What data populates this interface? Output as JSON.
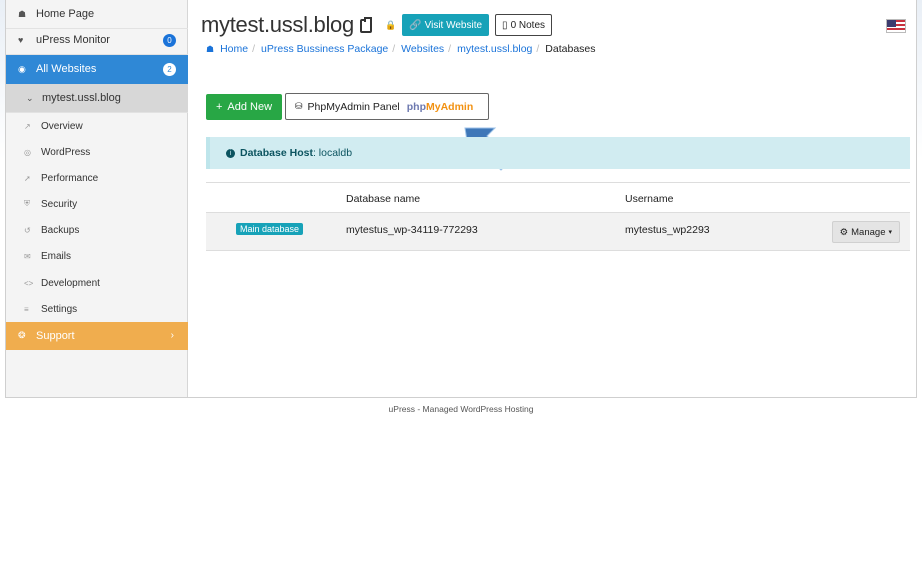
{
  "sidebar": {
    "items": [
      {
        "label": "Home Page",
        "icon": "home-icon"
      },
      {
        "label": "uPress Monitor",
        "icon": "heartbeat-icon",
        "badge": "0"
      },
      {
        "label": "All Websites",
        "icon": "globe-icon",
        "badge": "2"
      },
      {
        "label": "mytest.ussl.blog",
        "icon": "chevron-down-icon"
      }
    ],
    "sub_items": [
      {
        "label": "Overview",
        "icon": "chart-icon"
      },
      {
        "label": "WordPress",
        "icon": "wordpress-icon"
      },
      {
        "label": "Performance",
        "icon": "rocket-icon"
      },
      {
        "label": "Security",
        "icon": "shield-icon"
      },
      {
        "label": "Backups",
        "icon": "history-icon"
      },
      {
        "label": "Emails",
        "icon": "envelope-icon"
      },
      {
        "label": "Development",
        "icon": "code-icon"
      },
      {
        "label": "Settings",
        "icon": "sliders-icon"
      }
    ],
    "support": {
      "label": "Support",
      "icon": "lifebuoy-icon"
    }
  },
  "header": {
    "site_title": "mytest.ussl.blog",
    "visit_label": "Visit Website",
    "notes_label": "0 Notes"
  },
  "breadcrumb": [
    "Home",
    "uPress Bussiness Package",
    "Websites",
    "mytest.ussl.blog",
    "Databases"
  ],
  "actions": {
    "add_new": "Add New",
    "pma_panel": "PhpMyAdmin Panel",
    "pma_logo_php": "php",
    "pma_logo_admin": "MyAdmin"
  },
  "alert": {
    "label": "Database Host",
    "value": ": localdb"
  },
  "table": {
    "headers": [
      "Database name",
      "Username"
    ],
    "rows": [
      {
        "badge": "Main database",
        "db_name": "mytestus_wp-34119-772293",
        "username": "mytestus_wp2293",
        "manage": "Manage"
      }
    ]
  },
  "footer": "uPress - Managed WordPress Hosting",
  "colors": {
    "primary": "#2f88d6",
    "success": "#28a745",
    "info": "#17a2b8",
    "warning": "#f0ad4e",
    "alert_bg": "#d1ecf1"
  }
}
